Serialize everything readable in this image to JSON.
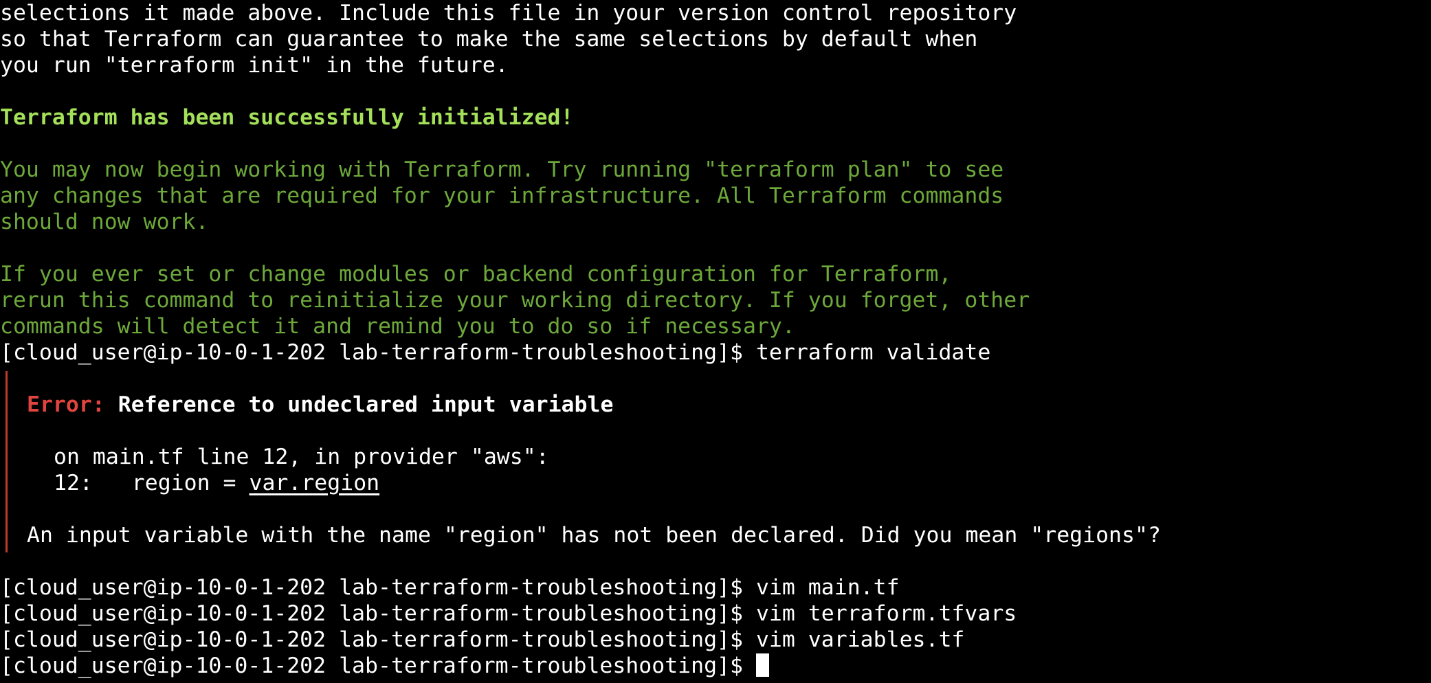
{
  "terminal": {
    "init_output": [
      "selections it made above. Include this file in your version control repository",
      "so that Terraform can guarantee to make the same selections by default when",
      "you run \"terraform init\" in the future."
    ],
    "success_heading": "Terraform has been successfully initialized!",
    "success_message_1": [
      "You may now begin working with Terraform. Try running \"terraform plan\" to see",
      "any changes that are required for your infrastructure. All Terraform commands",
      "should now work."
    ],
    "success_message_2": [
      "If you ever set or change modules or backend configuration for Terraform,",
      "rerun this command to reinitialize your working directory. If you forget, other",
      "commands will detect it and remind you to do so if necessary."
    ],
    "prompt": "[cloud_user@ip-10-0-1-202 lab-terraform-troubleshooting]$ ",
    "validate_command": "terraform validate",
    "error": {
      "label": "Error:",
      "title": "Reference to undeclared input variable",
      "location": "on main.tf line 12, in provider \"aws\":",
      "code_line_prefix": "12:   region = ",
      "code_line_ref": "var.region",
      "detail": "An input variable with the name \"region\" has not been declared. Did you mean \"regions\"?"
    },
    "commands": [
      "vim main.tf",
      "vim terraform.tfvars",
      "vim variables.tf"
    ]
  }
}
